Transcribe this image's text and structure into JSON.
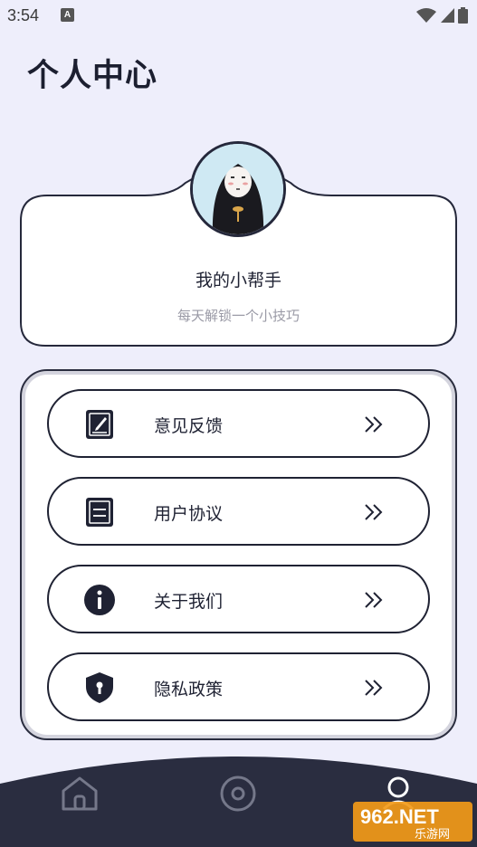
{
  "status_bar": {
    "time": "3:54",
    "notification_glyph": "A"
  },
  "header": {
    "title": "个人中心"
  },
  "profile": {
    "name": "我的小帮手",
    "subtitle": "每天解锁一个小技巧"
  },
  "menu": {
    "items": [
      {
        "label": "意见反馈",
        "icon": "feedback-icon"
      },
      {
        "label": "用户协议",
        "icon": "document-icon"
      },
      {
        "label": "关于我们",
        "icon": "info-icon"
      },
      {
        "label": "隐私政策",
        "icon": "shield-lock-icon"
      }
    ]
  },
  "bottom_nav": {
    "items": [
      {
        "name": "home-icon"
      },
      {
        "name": "target-icon"
      },
      {
        "name": "profile-icon",
        "active": true
      }
    ]
  },
  "watermark": {
    "line1": "962.NET",
    "line2": "乐游网"
  },
  "colors": {
    "background": "#eeeefb",
    "primary_dark": "#1f2233",
    "muted_text": "#9a9aa6"
  }
}
